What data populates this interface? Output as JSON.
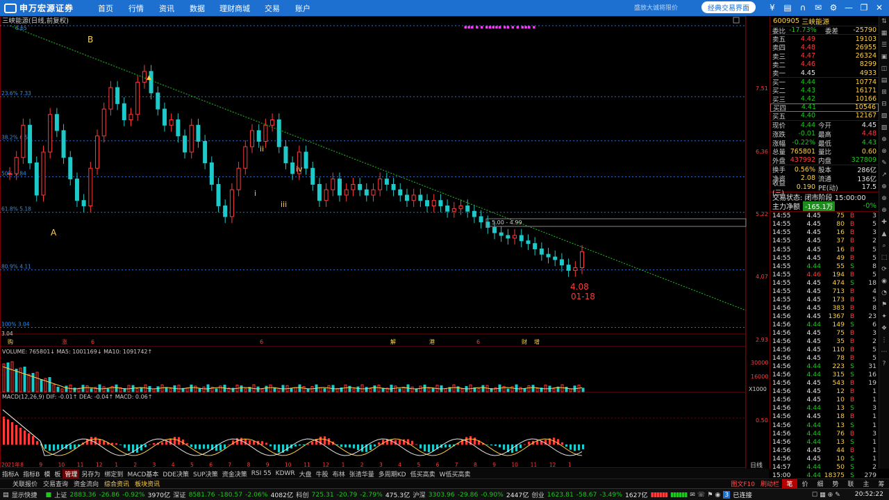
{
  "topbar": {
    "logo": "申万宏源证券",
    "nav": [
      "首页",
      "行情",
      "资讯",
      "数据",
      "理财商城",
      "交易",
      "账户"
    ],
    "hint": "盛放大诚将限价",
    "classic_btn": "经典交易界面",
    "icons": [
      "coin-icon",
      "book-icon",
      "headset-icon",
      "mail-icon",
      "gear-icon",
      "minimize-icon",
      "restore-icon",
      "close-icon"
    ]
  },
  "chart": {
    "title": "三峡能源(日线,前复权)",
    "price_levels": [
      "7.51",
      "6.36",
      "5.22",
      "4.07",
      "2.93"
    ],
    "fib_labels": [
      {
        "text": "8.65"
      },
      {
        "text": "23.6% 7.33"
      },
      {
        "text": "38.2% 6.51"
      },
      {
        "text": "50% 5.84"
      },
      {
        "text": "61.8% 5.18"
      },
      {
        "text": "80.9% 4.11"
      },
      {
        "text": "100% 3.04"
      },
      {
        "text": "3.04"
      }
    ],
    "wave_labels": [
      "B",
      "A",
      "i",
      "ii",
      "iii",
      "iv"
    ],
    "range_box": "5.00 - 4.99",
    "low_price": "4.08",
    "low_date": "01-18",
    "event_marks": [
      "购",
      "涨",
      "6",
      "6",
      "解",
      "港",
      "6",
      "财",
      "增"
    ],
    "volume_header": "VOLUME: 765801↓  MA5: 1001169↓  MA10: 1091742↑",
    "volume_levels": [
      "30000",
      "16000",
      "X1000"
    ],
    "macd_header": "MACD(12,26,9)  DIF: -0.01↑  DEA: -0.04↑  MACD: 0.06↑",
    "macd_level": "0.50",
    "x_labels": [
      "2021年",
      "8",
      "9",
      "10",
      "11",
      "12",
      "1",
      "2",
      "3",
      "4",
      "5",
      "6",
      "7",
      "8",
      "9",
      "10",
      "11",
      "12",
      "1",
      "2",
      "3",
      "4",
      "5",
      "6",
      "7",
      "8",
      "9",
      "10",
      "11",
      "12",
      "1"
    ],
    "period": "日线"
  },
  "chart_data": {
    "type": "line",
    "title": "三峡能源(日线,前复权)",
    "xlabel": "",
    "ylabel": "",
    "ylim": [
      2.93,
      8.65
    ],
    "trendline": {
      "from": 8.65,
      "to": 4.07
    },
    "fibonacci": [
      8.65,
      7.33,
      6.51,
      5.84,
      5.18,
      4.11,
      3.04
    ],
    "series": [
      {
        "values": [
          5.9,
          6.2,
          6.8,
          6.1,
          5.5,
          6.3,
          7.0,
          6.7,
          6.2,
          5.8,
          5.4,
          5.3,
          6.0,
          6.6,
          7.1,
          7.5,
          7.2,
          6.9,
          7.0,
          7.6,
          7.8,
          7.4,
          7.1,
          6.8,
          6.9,
          6.6,
          6.3,
          6.8,
          6.5,
          6.1,
          5.7,
          5.3,
          5.1,
          5.6,
          6.0,
          6.4,
          6.7,
          6.5,
          6.8,
          6.9,
          6.4,
          6.1,
          5.9,
          6.3,
          6.0,
          5.7,
          5.4,
          5.6,
          5.8,
          5.5,
          5.6,
          5.7,
          5.6,
          5.5,
          5.6,
          5.8,
          5.7,
          5.6,
          5.5,
          5.4,
          5.5,
          5.4,
          5.3,
          5.4,
          5.3,
          5.2,
          5.25,
          5.3,
          5.2,
          5.1,
          5.0,
          4.9,
          4.8,
          4.75,
          4.7,
          4.75,
          4.65,
          4.6,
          4.5,
          4.4,
          4.35,
          4.3,
          4.2,
          4.1,
          4.15,
          4.45
        ]
      }
    ]
  },
  "indicators": [
    "指标A",
    "指标B",
    "模",
    "板",
    "管理",
    "另存为",
    "绑定到",
    "MACD基本",
    "DDE决策",
    "SUP决策",
    "资金决策",
    "RSI 55",
    "KDWR",
    "大盘",
    "牛股",
    "布林",
    "张清华量",
    "多周期KD",
    "低买高卖",
    "W低买高卖"
  ],
  "func_bar": {
    "items": [
      "关联报价",
      "交易查询",
      "资金流向",
      "综合资讯",
      "板块资讯"
    ],
    "right_pre": [
      "图文F10",
      "刷动栏"
    ],
    "right_tabs": [
      "笔",
      "价",
      "细",
      "势",
      "联",
      "主",
      "筹"
    ]
  },
  "ticker": {
    "label": "显示快捷",
    "sh_name": "上证",
    "sh_price": "2883.36",
    "sh_chg": "-26.86",
    "sh_pct": "-0.92%",
    "sh_amt": "3970亿",
    "sz_name": "深证",
    "sz_price": "8581.76",
    "sz_chg": "-180.57",
    "sz_pct": "-2.06%",
    "sz_amt": "4082亿",
    "kc_name": "科创",
    "kc_price": "725.31",
    "kc_chg": "-20.79",
    "kc_pct": "-2.79%",
    "kc_amt": "475.3亿",
    "hs_name": "沪深",
    "hs_price": "3303.96",
    "hs_chg": "-29.86",
    "hs_pct": "-0.90%",
    "hs_amt": "2447亿",
    "cy_name": "创业",
    "cy_price": "1623.81",
    "cy_chg": "-58.67",
    "cy_pct": "-3.49%",
    "cy_amt": "1627亿",
    "connected": "已连接",
    "time": "20:52:22"
  },
  "panel": {
    "code": "600905",
    "name": "三峡能源",
    "webi": {
      "label": "委比",
      "value": "-17.73%",
      "label2": "委差",
      "value2": "-25790"
    },
    "asks": [
      {
        "label": "卖五",
        "price": "4.49",
        "vol": "19103"
      },
      {
        "label": "卖四",
        "price": "4.48",
        "vol": "26955"
      },
      {
        "label": "卖三",
        "price": "4.47",
        "vol": "26324"
      },
      {
        "label": "卖二",
        "price": "4.46",
        "vol": "8299"
      },
      {
        "label": "卖一",
        "price": "4.45",
        "vol": "4933"
      }
    ],
    "bids": [
      {
        "label": "买一",
        "price": "4.44",
        "vol": "10774"
      },
      {
        "label": "买二",
        "price": "4.43",
        "vol": "16171"
      },
      {
        "label": "买三",
        "price": "4.42",
        "vol": "10166"
      },
      {
        "label": "买四",
        "price": "4.41",
        "vol": "10546"
      },
      {
        "label": "买五",
        "price": "4.40",
        "vol": "12167"
      }
    ],
    "quote": [
      {
        "l1": "现价",
        "v1": "4.44",
        "c1": "green",
        "l2": "今开",
        "v2": "4.45",
        "c2": "white"
      },
      {
        "l1": "涨跌",
        "v1": "-0.01",
        "c1": "green",
        "l2": "最高",
        "v2": "4.48",
        "c2": "red"
      },
      {
        "l1": "涨幅",
        "v1": "-0.22%",
        "c1": "green",
        "l2": "最低",
        "v2": "4.43",
        "c2": "green"
      },
      {
        "l1": "总量",
        "v1": "765801",
        "c1": "yellow",
        "l2": "量比",
        "v2": "0.60",
        "c2": "yellow"
      },
      {
        "l1": "外盘",
        "v1": "437992",
        "c1": "red",
        "l2": "内盘",
        "v2": "327809",
        "c2": "green"
      }
    ],
    "fund": [
      {
        "l1": "换手",
        "v1": "0.56%",
        "l2": "股本",
        "v2": "286亿"
      },
      {
        "l1": "净资",
        "v1": "2.08",
        "l2": "流通",
        "v2": "136亿"
      },
      {
        "l1": "收益(三)",
        "v1": "0.190",
        "l2": "PE(动)",
        "v2": "17.5"
      }
    ],
    "status": "交易状态: 闭市阶段 15:00:00",
    "mainforce_label": "主力净额",
    "mainforce_value": "-165.1万",
    "mainforce_pct": "-0%",
    "ticks": [
      [
        "14:55",
        "4.45",
        "75",
        "B",
        "3"
      ],
      [
        "14:55",
        "4.45",
        "80",
        "B",
        "5"
      ],
      [
        "14:55",
        "4.45",
        "16",
        "B",
        "3"
      ],
      [
        "14:55",
        "4.45",
        "37",
        "B",
        "2"
      ],
      [
        "14:55",
        "4.45",
        "16",
        "B",
        "5"
      ],
      [
        "14:55",
        "4.45",
        "49",
        "B",
        "5"
      ],
      [
        "14:55",
        "4.44",
        "55",
        "S",
        "8"
      ],
      [
        "14:55",
        "4.46",
        "194",
        "B",
        "5"
      ],
      [
        "14:55",
        "4.45",
        "474",
        "S",
        "18"
      ],
      [
        "14:55",
        "4.45",
        "713",
        "B",
        "4"
      ],
      [
        "14:55",
        "4.45",
        "173",
        "B",
        "5"
      ],
      [
        "14:56",
        "4.45",
        "383",
        "B",
        "8"
      ],
      [
        "14:56",
        "4.45",
        "1367",
        "B",
        "23"
      ],
      [
        "14:56",
        "4.44",
        "149",
        "S",
        "6"
      ],
      [
        "14:56",
        "4.45",
        "75",
        "B",
        "3"
      ],
      [
        "14:56",
        "4.45",
        "35",
        "B",
        "2"
      ],
      [
        "14:56",
        "4.45",
        "110",
        "B",
        "5"
      ],
      [
        "14:56",
        "4.45",
        "78",
        "B",
        "5"
      ],
      [
        "14:56",
        "4.44",
        "223",
        "S",
        "31"
      ],
      [
        "14:56",
        "4.44",
        "315",
        "S",
        "16"
      ],
      [
        "14:56",
        "4.45",
        "543",
        "B",
        "19"
      ],
      [
        "14:56",
        "4.45",
        "12",
        "B",
        "1"
      ],
      [
        "14:56",
        "4.45",
        "10",
        "B",
        "1"
      ],
      [
        "14:56",
        "4.44",
        "13",
        "S",
        "3"
      ],
      [
        "14:56",
        "4.45",
        "18",
        "B",
        "1"
      ],
      [
        "14:56",
        "4.44",
        "13",
        "S",
        "1"
      ],
      [
        "14:56",
        "4.44",
        "76",
        "B",
        "3"
      ],
      [
        "14:56",
        "4.44",
        "13",
        "S",
        "1"
      ],
      [
        "14:56",
        "4.45",
        "44",
        "B",
        "1"
      ],
      [
        "14:56",
        "4.45",
        "10",
        "S",
        "1"
      ],
      [
        "14:57",
        "4.44",
        "50",
        "S",
        "2"
      ],
      [
        "15:00",
        "4.44",
        "18375",
        "S",
        "279"
      ]
    ]
  }
}
